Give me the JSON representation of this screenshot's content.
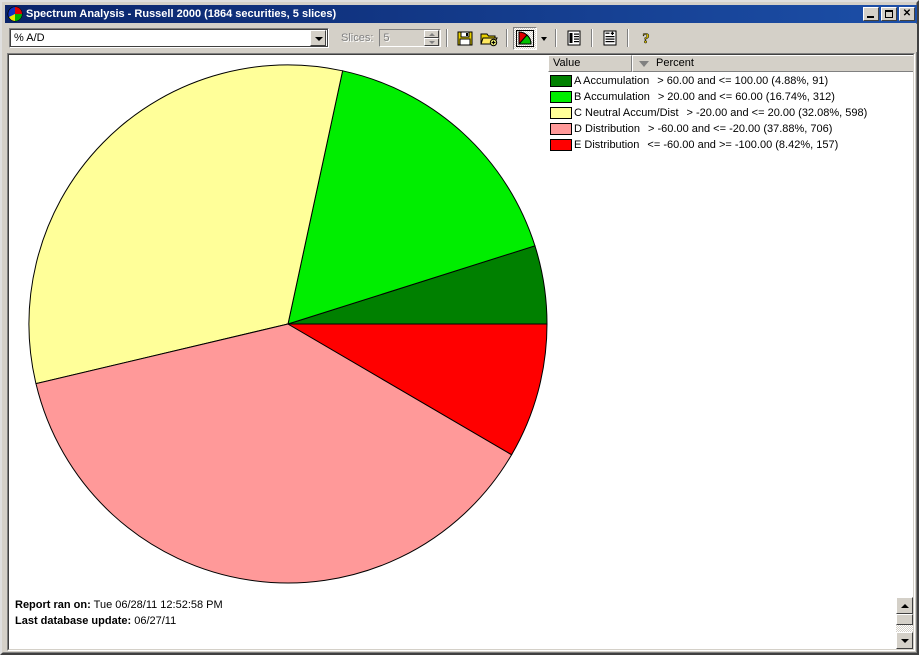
{
  "window": {
    "title": "Spectrum Analysis - Russell 2000 (1864 securities, 5 slices)",
    "icon": "pie-chart-icon",
    "minimize_label": "_",
    "maximize_label": "□",
    "close_label": "✕"
  },
  "toolbar": {
    "metric_select_value": "% A/D",
    "metric_select_placeholder": "% A/D",
    "slices_label": "Slices:",
    "slices_value": "5",
    "buttons": [
      {
        "name": "save-report-button",
        "icon": "floppy-disk-icon",
        "tooltip": "Save"
      },
      {
        "name": "open-report-button",
        "icon": "open-folder-plus-icon",
        "tooltip": "Open"
      },
      {
        "name": "pie-chart-view-button",
        "icon": "pie-chart-icon",
        "tooltip": "Chart view",
        "pressed": true
      },
      {
        "name": "chart-type-dropdown-button",
        "icon": "chevron-down-icon",
        "tooltip": "Chart type"
      },
      {
        "name": "list-view-button",
        "icon": "list-report-icon",
        "tooltip": "List view"
      },
      {
        "name": "add-report-button",
        "icon": "report-plus-icon",
        "tooltip": "New report"
      },
      {
        "name": "help-button",
        "icon": "question-mark-icon",
        "tooltip": "Help"
      }
    ]
  },
  "legend": {
    "columns": [
      "Value",
      "Percent"
    ],
    "sort_indicator": "sort-descending-icon",
    "rows": [
      {
        "key": "A",
        "label": "A Accumulation",
        "desc": "> 60.00 and <= 100.00 (4.88%, 91)",
        "color": "#008000"
      },
      {
        "key": "B",
        "label": "B Accumulation",
        "desc": "> 20.00 and <= 60.00 (16.74%, 312)",
        "color": "#00EE00"
      },
      {
        "key": "C",
        "label": "C Neutral Accum/Dist",
        "desc": "> -20.00 and <= 20.00 (32.08%, 598)",
        "color": "#FFFF99"
      },
      {
        "key": "D",
        "label": "D Distribution",
        "desc": "> -60.00 and <= -20.00 (37.88%, 706)",
        "color": "#FF9999"
      },
      {
        "key": "E",
        "label": "E Distribution",
        "desc": "<= -60.00 and >= -100.00 (8.42%, 157)",
        "color": "#FF0000"
      }
    ]
  },
  "footer": {
    "report_ran_label": "Report ran on:",
    "report_ran_value": "Tue 06/28/11 12:52:58 PM",
    "last_update_label": "Last database update:",
    "last_update_value": "06/27/11"
  },
  "chart_data": {
    "type": "pie",
    "title": "Spectrum Analysis - Russell 2000",
    "total_securities": 1864,
    "slice_count": 5,
    "start_angle_deg": 0,
    "direction": "counterclockwise",
    "categories": [
      "A Accumulation",
      "B Accumulation",
      "C Neutral Accum/Dist",
      "D Distribution",
      "E Distribution"
    ],
    "values": [
      4.88,
      16.74,
      32.08,
      37.88,
      8.42
    ],
    "counts": [
      91,
      312,
      598,
      706,
      157
    ],
    "colors": [
      "#008000",
      "#00EE00",
      "#FFFF99",
      "#FF9999",
      "#FF0000"
    ],
    "ranges": [
      "> 60.00 and <= 100.00",
      "> 20.00 and <= 60.00",
      "> -20.00 and <= 20.00",
      "> -60.00 and <= -20.00",
      "<= -60.00 and >= -100.00"
    ],
    "ylabel": "Percent",
    "xlabel": "Value",
    "legend_position": "top-right",
    "grid": false
  }
}
